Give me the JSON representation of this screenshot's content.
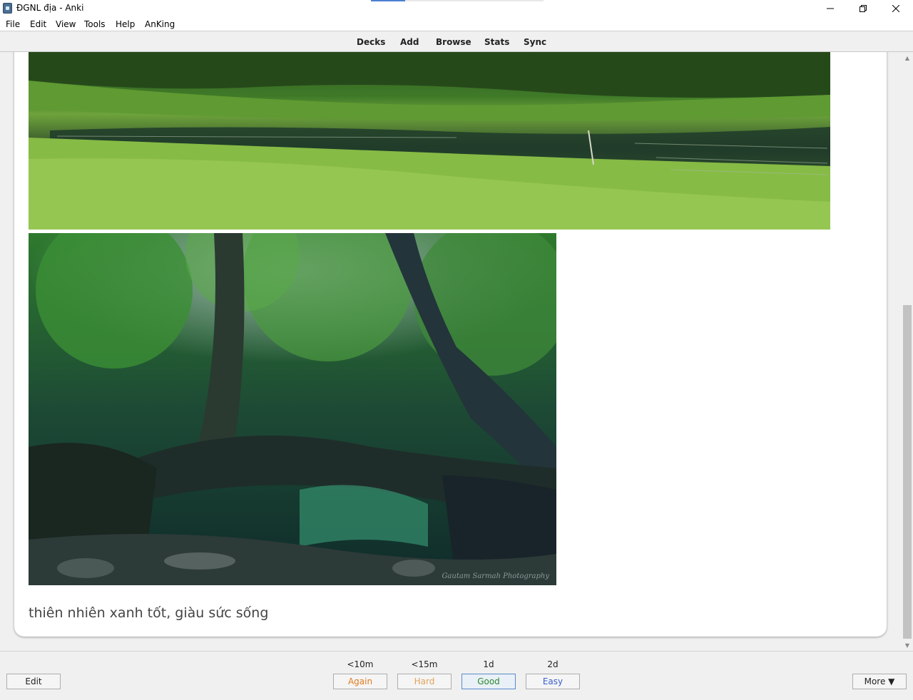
{
  "window": {
    "title": "ĐGNL địa - Anki",
    "minimize_glyph": "—",
    "maximize_glyph": "❐",
    "close_glyph": "✕"
  },
  "menu": {
    "items": [
      "File",
      "Edit",
      "View",
      "Tools",
      "Help",
      "AnKing"
    ]
  },
  "toolbar": {
    "links": [
      "Decks",
      "Add",
      "Browse",
      "Stats",
      "Sync"
    ]
  },
  "card": {
    "answer_text": "thiên nhiên xanh tốt, giàu sức sống",
    "image1_icon": "landscape-grassland-image",
    "image2_icon": "living-root-bridge-forest-image",
    "image2_watermark": "Gautam Sarmah Photography"
  },
  "bottom": {
    "edit_label": "Edit",
    "more_label": "More ▼",
    "answers": [
      {
        "time": "<10m",
        "label": "Again",
        "color": "#e07b1f"
      },
      {
        "time": "<15m",
        "label": "Hard",
        "color": "#e3a25a"
      },
      {
        "time": "1d",
        "label": "Good",
        "color": "#2c8a2c"
      },
      {
        "time": "2d",
        "label": "Easy",
        "color": "#3a5fcc"
      }
    ]
  },
  "colors": {
    "accent": "#4c7fd1",
    "toolbar_bg": "#f0f0f0"
  }
}
